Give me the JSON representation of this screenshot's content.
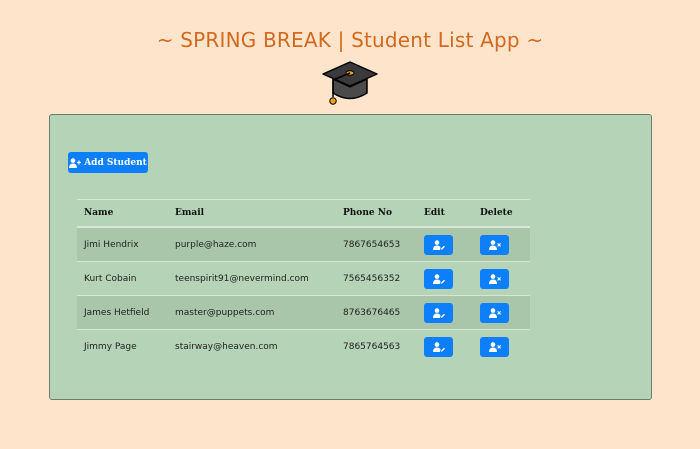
{
  "app": {
    "title": "~ SPRING BREAK | Student List App ~",
    "logo_icon": "graduation-cap-icon"
  },
  "toolbar": {
    "add_label": "Add Student",
    "add_icon": "user-plus-icon"
  },
  "table": {
    "headers": {
      "name": "Name",
      "email": "Email",
      "phone": "Phone No",
      "edit": "Edit",
      "delete": "Delete"
    },
    "rows": [
      {
        "name": "Jimi Hendrix",
        "email": "purple@haze.com",
        "phone": "7867654653"
      },
      {
        "name": "Kurt Cobain",
        "email": "teenspirit91@nevermind.com",
        "phone": "7565456352"
      },
      {
        "name": "James Hetfield",
        "email": "master@puppets.com",
        "phone": "8763676465"
      },
      {
        "name": "Jimmy Page",
        "email": "stairway@heaven.com",
        "phone": "7865764563"
      }
    ],
    "edit_icon": "user-edit-icon",
    "delete_icon": "user-remove-icon"
  },
  "colors": {
    "page_bg": "#fee4cb",
    "title": "#d2691e",
    "panel_bg": "#b5d3b6",
    "row_stripe": "#a9c6aa",
    "button": "#0d7ffb"
  }
}
